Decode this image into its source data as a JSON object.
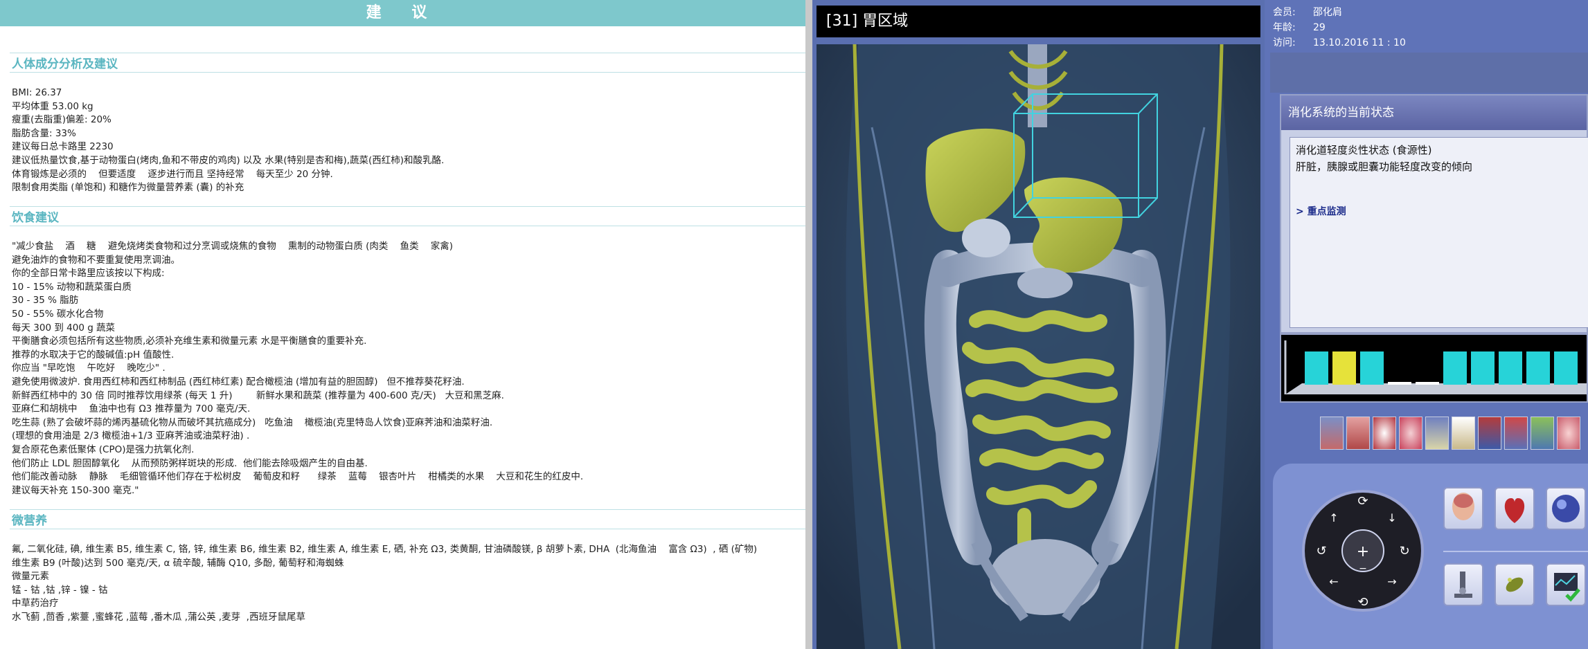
{
  "report": {
    "title": "建 议",
    "sections": [
      {
        "heading": "人体成分分析及建议",
        "lines": [
          "BMI: 26.37",
          "平均体重 53.00 kg",
          "瘦重(去脂重)偏差: 20%",
          "脂肪含量: 33%",
          "建议每日总卡路里 2230",
          "建议低热量饮食,基于动物蛋白(烤肉,鱼和不带皮的鸡肉) 以及 水果(特别是杏和梅),蔬菜(西红柿)和酸乳酪.",
          "体育锻炼是必须的    但要适度    逐步进行而且 坚持经常    每天至少 20 分钟.",
          "限制食用类脂 (单饱和) 和糖作为微量营养素 (囊) 的补充"
        ]
      },
      {
        "heading": "饮食建议",
        "lines": [
          "\"减少食盐    酒    糖    避免烧烤类食物和过分烹调或烧焦的食物    熏制的动物蛋白质 (肉类    鱼类    家禽)",
          "避免油炸的食物和不要重复使用烹调油。",
          "你的全部日常卡路里应该按以下构成:",
          "10 - 15% 动物和蔬菜蛋白质",
          "30 - 35 % 脂肪",
          "50 - 55% 碳水化合物",
          "每天 300 到 400 g 蔬菜",
          "平衡膳食必须包括所有这些物质,必须补充维生素和微量元素 水是平衡膳食的重要补充.",
          "推荐的水取决于它的酸碱值:pH 值酸性.",
          "你应当 \"早吃饱    午吃好    晚吃少\" .",
          "避免使用微波炉. 食用西红柿和西红柿制品 (西红柿红素) 配合橄榄油 (增加有益的胆固醇)   但不推荐葵花籽油.",
          "新鲜西红柿中的 30 倍 同时推荐饮用绿茶 (每天 1 升)        新鲜水果和蔬菜 (推荐量为 400-600 克/天)   大豆和黑芝麻.",
          "亚麻仁和胡桃中    鱼油中也有 Ω3 推荐量为 700 毫克/天.",
          "吃生蒜 (熟了会破坏蒜的烯丙基硫化物从而破坏其抗癌成分)   吃鱼油    橄榄油(克里特岛人饮食)亚麻荠油和油菜籽油.",
          "(理想的食用油是 2/3 橄榄油+1/3 亚麻荠油或油菜籽油) .",
          "复合原花色素低聚体 (CPO)是强力抗氧化剂.",
          "他们防止 LDL 胆固醇氧化    从而预防粥样斑块的形成.  他们能去除吸烟产生的自由基.",
          "他们能改善动脉    静脉    毛细管循环他们存在于松树皮    葡萄皮和籽      绿茶    蓝莓    银杏叶片    柑橘类的水果    大豆和花生的红皮中.",
          "建议每天补充 150-300 毫克.\""
        ]
      },
      {
        "heading": "微营养",
        "lines": [
          "氟, 二氧化硅, 碘, 维生素 B5, 维生素 C, 铬, 锌, 维生素 B6, 维生素 B2, 维生素 A, 维生素 E, 硒, 补充 Ω3, 类黄酮, 甘油磷酸镁, β 胡萝卜素, DHA  (北海鱼油    富含 Ω3)  , 硒 (矿物)",
          "维生素 B9 (叶酸)达到 500 毫克/天, α 硫辛酸, 辅酶 Q10, 多酚, 葡萄籽和海蜘蛛",
          "微量元素",
          "锰 - 钴 ,钴 ,锌 - 镍 - 钴",
          "中草药治疗",
          "水飞蓟 ,茴香 ,紫薹 ,蜜蜂花 ,蓝莓 ,番木瓜 ,蒲公英 ,麦芽  ,西班牙鼠尾草"
        ]
      }
    ]
  },
  "viewer": {
    "title": "[31] 胃区域"
  },
  "panel": {
    "info": [
      {
        "key": "会员:",
        "value": "邵化肩"
      },
      {
        "key": "年龄:",
        "value": "29"
      },
      {
        "key": "访问:",
        "value": "13.10.2016  11 : 10"
      }
    ],
    "status": {
      "title": "消化系统的当前状态",
      "lines": [
        "消化道轻度炎性状态 (食源性)",
        "肝脏，胰腺或胆囊功能轻度改变的倾向"
      ],
      "link": "> 重点监测"
    },
    "bars": [
      {
        "color": "#27d3d8",
        "level": 0.75
      },
      {
        "color": "#e6e23a",
        "level": 0.75
      },
      {
        "color": "#27d3d8",
        "level": 0.75
      },
      {
        "color": "#ffffff",
        "level": 0.05
      },
      {
        "color": "#ffffff",
        "level": 0.05
      },
      {
        "color": "#27d3d8",
        "level": 0.75
      },
      {
        "color": "#27d3d8",
        "level": 0.75
      },
      {
        "color": "#27d3d8",
        "level": 0.75
      },
      {
        "color": "#27d3d8",
        "level": 0.75
      },
      {
        "color": "#27d3d8",
        "level": 0.75
      }
    ],
    "thumbnails": [
      "lungs-thumb",
      "muscle-thumb",
      "blood-cells-thumb",
      "cells-thumb",
      "tissue-thumb",
      "spine-thumb",
      "nerves-thumb",
      "heart-vessels-thumb",
      "digestive-thumb",
      "cells-closeup-thumb"
    ],
    "tools": [
      "head-model-icon",
      "heart-model-icon",
      "cell-sphere-icon",
      "microscope-icon",
      "bacteria-icon",
      "chart-check-icon"
    ]
  },
  "colors": {
    "accent": "#7ec8cc",
    "heading": "#5bb6c1",
    "panel": "#5f73b8",
    "viewer_bg": "#2d3f5a",
    "organ_green": "#b5c24a"
  }
}
